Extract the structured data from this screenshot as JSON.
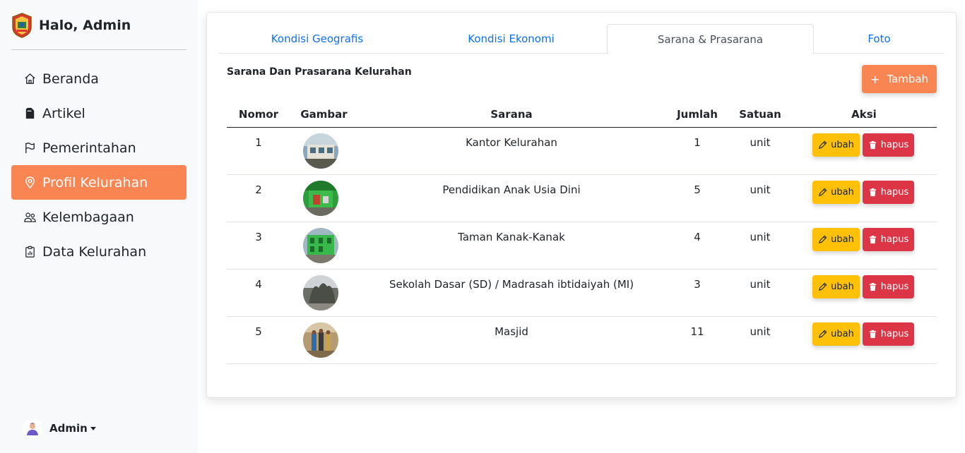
{
  "sidebar": {
    "greeting": "Halo, Admin",
    "items": [
      {
        "label": "Beranda",
        "icon": "house-icon"
      },
      {
        "label": "Artikel",
        "icon": "file-icon"
      },
      {
        "label": "Pemerintahan",
        "icon": "flag-icon"
      },
      {
        "label": "Profil Kelurahan",
        "icon": "pin-icon",
        "active": true
      },
      {
        "label": "Kelembagaan",
        "icon": "people-icon"
      },
      {
        "label": "Data Kelurahan",
        "icon": "clipboard-chart-icon"
      }
    ],
    "user": "Admin"
  },
  "tabs": [
    {
      "label": "Kondisi Geografis"
    },
    {
      "label": "Kondisi Ekonomi"
    },
    {
      "label": "Sarana & Prasarana",
      "active": true
    },
    {
      "label": "Foto"
    }
  ],
  "main": {
    "section_title": "Sarana Dan Prasarana Kelurahan",
    "add_label": "Tambah",
    "add_plus": "+"
  },
  "table": {
    "headers": {
      "nomor": "Nomor",
      "gambar": "Gambar",
      "sarana": "Sarana",
      "jumlah": "Jumlah",
      "satuan": "Satuan",
      "aksi": "Aksi"
    },
    "edit_label": "ubah",
    "delete_label": "hapus",
    "rows": [
      {
        "nomor": "1",
        "sarana": "Kantor Kelurahan",
        "jumlah": "1",
        "satuan": "unit"
      },
      {
        "nomor": "2",
        "sarana": "Pendidikan Anak Usia Dini",
        "jumlah": "5",
        "satuan": "unit"
      },
      {
        "nomor": "3",
        "sarana": "Taman Kanak-Kanak",
        "jumlah": "4",
        "satuan": "unit"
      },
      {
        "nomor": "4",
        "sarana": "Sekolah Dasar (SD) / Madrasah ibtidaiyah (MI)",
        "jumlah": "3",
        "satuan": "unit"
      },
      {
        "nomor": "5",
        "sarana": "Masjid",
        "jumlah": "11",
        "satuan": "unit"
      }
    ]
  },
  "colors": {
    "accent": "#f98553",
    "link": "#0d6efd",
    "edit": "#ffc107",
    "delete": "#dc3545"
  }
}
